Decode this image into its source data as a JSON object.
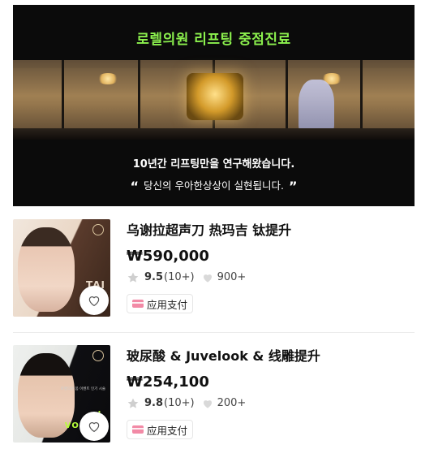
{
  "banner": {
    "title": "로렐의원 리프팅 중점진료",
    "subtitle_line1": "10년간 리프팅만을 연구해왔습니다.",
    "subtitle_line2": "당신의 우아한상상이 실현됩니다.",
    "quote_open": "“",
    "quote_close": "”",
    "accent_color": "#8cf24e"
  },
  "products": [
    {
      "name": "乌谢拉超声刀 热玛吉 钛提升",
      "price": "₩590,000",
      "rating": "9.5",
      "review_count": "(10+)",
      "likes": "900+",
      "payment_badge": "应用支付",
      "thumb_text_a": "TAI",
      "thumb_text_b": "LI"
    },
    {
      "name": "玻尿酸 & Juvelook & 线雕提升",
      "price": "₩254,100",
      "rating": "9.8",
      "review_count": "(10+)",
      "likes": "200+",
      "payment_badge": "应用支付",
      "thumb_text_a": "L",
      "thumb_text_b": "VOLU",
      "thumb_tiny_copy": "로렐의원 봄 이벤트 인기 시술"
    }
  ],
  "icons": {
    "star": "star-icon",
    "heart": "heart-icon",
    "wishlist": "wishlist-heart-icon",
    "payment": "card-icon"
  }
}
